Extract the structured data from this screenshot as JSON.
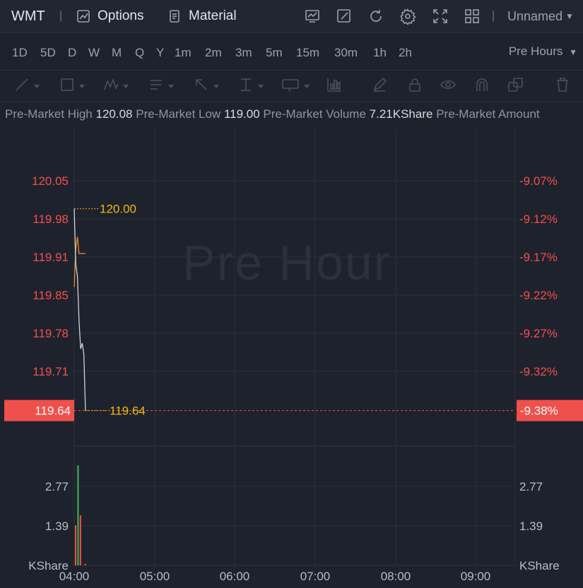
{
  "topbar": {
    "ticker": "WMT",
    "separator": "|",
    "options_label": "Options",
    "material_label": "Material",
    "layout_name": "Unnamed",
    "icons": [
      "indicator-icon",
      "draw-icon",
      "refresh-icon",
      "settings-icon",
      "fullscreen-icon",
      "layout-grid-icon"
    ]
  },
  "timeframes": {
    "items": [
      "1D",
      "5D",
      "D",
      "W",
      "M",
      "Q",
      "Y",
      "1m",
      "2m",
      "3m",
      "5m",
      "15m",
      "30m",
      "1h",
      "2h"
    ],
    "active": "1D",
    "session_label": "Pre Hours"
  },
  "drawing_tools": [
    "line-tool-icon",
    "rectangle-tool-icon",
    "pattern-tool-icon",
    "text-tool-icon",
    "arrow-tool-icon",
    "measure-tool-icon",
    "label-tool-icon",
    "indicator-tool-icon",
    "pencil-icon",
    "lock-icon",
    "eye-icon",
    "magnet-icon",
    "copy-icon",
    "trash-icon"
  ],
  "stats": {
    "high_label": "Pre-Market High",
    "high_value": "120.08",
    "low_label": "Pre-Market Low",
    "low_value": "119.00",
    "volume_label": "Pre-Market Volume",
    "volume_value": "7.21KShare",
    "amount_label": "Pre-Market Amount"
  },
  "watermark": "Pre Hour",
  "colors": {
    "up": "#3fb950",
    "down": "#f0504c",
    "accent": "#f0b90b",
    "price_line": "#d0d3d8",
    "avg_line": "#f08a24"
  },
  "chart_data": {
    "type": "line",
    "price_axis_left": [
      "120.05",
      "119.98",
      "119.91",
      "119.85",
      "119.78",
      "119.71"
    ],
    "price_axis_right": [
      "-9.07%",
      "-9.12%",
      "-9.17%",
      "-9.22%",
      "-9.27%",
      "-9.32%"
    ],
    "current_price": "119.64",
    "current_pct": "-9.38%",
    "high_marker": "120.00",
    "low_marker": "119.64",
    "volume_axis": [
      "2.77",
      "1.39"
    ],
    "volume_unit": "KShare",
    "x_ticks": [
      "04:00",
      "05:00",
      "06:00",
      "07:00",
      "08:00",
      "09:00"
    ],
    "ylim": [
      119.6,
      120.11
    ],
    "price_series": [
      {
        "t": 0.0,
        "v": 120.0
      },
      {
        "t": 0.02,
        "v": 119.9
      },
      {
        "t": 0.04,
        "v": 119.88
      },
      {
        "t": 0.06,
        "v": 119.8
      },
      {
        "t": 0.08,
        "v": 119.75
      },
      {
        "t": 0.1,
        "v": 119.76
      },
      {
        "t": 0.12,
        "v": 119.74
      },
      {
        "t": 0.14,
        "v": 119.64
      }
    ],
    "avg_series": [
      {
        "t": 0.0,
        "v": 119.86
      },
      {
        "t": 0.02,
        "v": 119.93
      },
      {
        "t": 0.04,
        "v": 119.95
      },
      {
        "t": 0.06,
        "v": 119.92
      },
      {
        "t": 0.1,
        "v": 119.92
      },
      {
        "t": 0.14,
        "v": 119.92
      }
    ],
    "volume": [
      {
        "t": 0.0,
        "v": 1.2,
        "dir": "down"
      },
      {
        "t": 0.03,
        "v": 3.0,
        "dir": "up"
      },
      {
        "t": 0.06,
        "v": 1.5,
        "dir": "down"
      },
      {
        "t": 0.12,
        "v": 0.05,
        "dir": "down"
      }
    ],
    "volume_max": 3.3
  }
}
